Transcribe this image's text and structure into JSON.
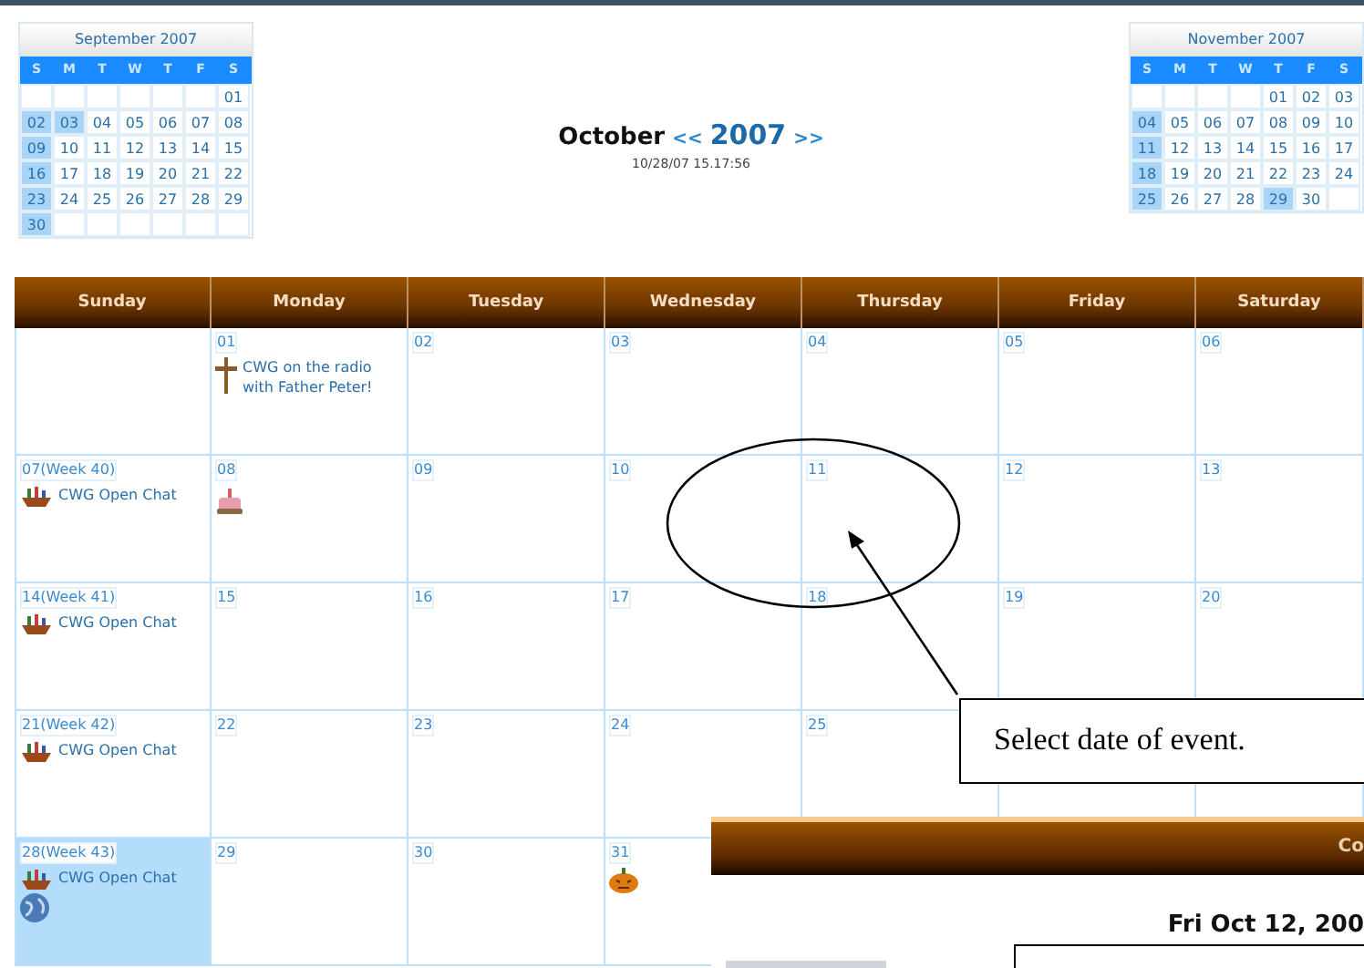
{
  "mini_calendars": [
    {
      "title": "September 2007",
      "weekday_headers": [
        "S",
        "M",
        "T",
        "W",
        "T",
        "F",
        "S"
      ],
      "weeks": [
        [
          {
            "day": "01",
            "highlighted": false
          }
        ],
        [
          {
            "day": "02",
            "highlighted": true
          },
          {
            "day": "03",
            "highlighted": true
          },
          {
            "day": "04",
            "highlighted": false
          },
          {
            "day": "05",
            "highlighted": false
          },
          {
            "day": "06",
            "highlighted": false
          },
          {
            "day": "07",
            "highlighted": false
          },
          {
            "day": "08",
            "highlighted": false
          }
        ],
        [
          {
            "day": "09",
            "highlighted": true
          },
          {
            "day": "10",
            "highlighted": false
          },
          {
            "day": "11",
            "highlighted": false
          },
          {
            "day": "12",
            "highlighted": false
          },
          {
            "day": "13",
            "highlighted": false
          },
          {
            "day": "14",
            "highlighted": false
          },
          {
            "day": "15",
            "highlighted": false
          }
        ],
        [
          {
            "day": "16",
            "highlighted": true
          },
          {
            "day": "17",
            "highlighted": false
          },
          {
            "day": "18",
            "highlighted": false
          },
          {
            "day": "19",
            "highlighted": false
          },
          {
            "day": "20",
            "highlighted": false
          },
          {
            "day": "21",
            "highlighted": false
          },
          {
            "day": "22",
            "highlighted": false
          }
        ],
        [
          {
            "day": "23",
            "highlighted": true
          },
          {
            "day": "24",
            "highlighted": false
          },
          {
            "day": "25",
            "highlighted": false
          },
          {
            "day": "26",
            "highlighted": false
          },
          {
            "day": "27",
            "highlighted": false
          },
          {
            "day": "28",
            "highlighted": false
          },
          {
            "day": "29",
            "highlighted": false
          }
        ],
        [
          {
            "day": "30",
            "highlighted": true
          }
        ]
      ]
    },
    {
      "title": "November 2007",
      "weekday_headers": [
        "S",
        "M",
        "T",
        "W",
        "T",
        "F",
        "S"
      ],
      "weeks": [
        [
          {
            "day": "01",
            "highlighted": false
          },
          {
            "day": "02",
            "highlighted": false
          },
          {
            "day": "03",
            "highlighted": false
          }
        ],
        [
          {
            "day": "04",
            "highlighted": true
          },
          {
            "day": "05",
            "highlighted": false
          },
          {
            "day": "06",
            "highlighted": false
          },
          {
            "day": "07",
            "highlighted": false
          },
          {
            "day": "08",
            "highlighted": false
          },
          {
            "day": "09",
            "highlighted": false
          },
          {
            "day": "10",
            "highlighted": false
          }
        ],
        [
          {
            "day": "11",
            "highlighted": true
          },
          {
            "day": "12",
            "highlighted": false
          },
          {
            "day": "13",
            "highlighted": false
          },
          {
            "day": "14",
            "highlighted": false
          },
          {
            "day": "15",
            "highlighted": false
          },
          {
            "day": "16",
            "highlighted": false
          },
          {
            "day": "17",
            "highlighted": false
          }
        ],
        [
          {
            "day": "18",
            "highlighted": true
          },
          {
            "day": "19",
            "highlighted": false
          },
          {
            "day": "20",
            "highlighted": false
          },
          {
            "day": "21",
            "highlighted": false
          },
          {
            "day": "22",
            "highlighted": false
          },
          {
            "day": "23",
            "highlighted": false
          },
          {
            "day": "24",
            "highlighted": false
          }
        ],
        [
          {
            "day": "25",
            "highlighted": true
          },
          {
            "day": "26",
            "highlighted": false
          },
          {
            "day": "27",
            "highlighted": false
          },
          {
            "day": "28",
            "highlighted": false
          },
          {
            "day": "29",
            "highlighted": true
          },
          {
            "day": "30",
            "highlighted": false
          }
        ]
      ]
    }
  ],
  "title": {
    "month": "October",
    "prev": "<<",
    "year": "2007",
    "next": ">>",
    "timestamp": "10/28/07 15.17:56"
  },
  "calendar": {
    "weekdays": [
      "Sunday",
      "Monday",
      "Tuesday",
      "Wednesday",
      "Thursday",
      "Friday",
      "Saturday"
    ],
    "weeks": [
      [
        {
          "date": "01",
          "highlighted": false,
          "events": [
            {
              "kind": "cross",
              "text": "CWG on the radio with Father Peter!"
            }
          ]
        },
        {
          "date": "02",
          "highlighted": false
        },
        {
          "date": "03",
          "highlighted": false
        },
        {
          "date": "04",
          "highlighted": false
        },
        {
          "date": "05",
          "highlighted": false
        },
        {
          "date": "06",
          "highlighted": false
        }
      ],
      [
        {
          "date": "07(Week 40)",
          "highlighted": false,
          "events": [
            {
              "kind": "boat",
              "text": "CWG Open Chat"
            }
          ]
        },
        {
          "date": "08",
          "highlighted": false,
          "events": [
            {
              "kind": "cake"
            }
          ]
        },
        {
          "date": "09",
          "highlighted": false
        },
        {
          "date": "10",
          "highlighted": false
        },
        {
          "date": "11",
          "highlighted": false
        },
        {
          "date": "12",
          "highlighted": false
        },
        {
          "date": "13",
          "highlighted": false
        }
      ],
      [
        {
          "date": "14(Week 41)",
          "highlighted": false,
          "events": [
            {
              "kind": "boat",
              "text": "CWG Open Chat"
            }
          ]
        },
        {
          "date": "15",
          "highlighted": false
        },
        {
          "date": "16",
          "highlighted": false
        },
        {
          "date": "17",
          "highlighted": false
        },
        {
          "date": "18",
          "highlighted": false
        },
        {
          "date": "19",
          "highlighted": false
        },
        {
          "date": "20",
          "highlighted": false
        }
      ],
      [
        {
          "date": "21(Week 42)",
          "highlighted": false,
          "events": [
            {
              "kind": "boat",
              "text": "CWG Open Chat"
            }
          ]
        },
        {
          "date": "22",
          "highlighted": false
        },
        {
          "date": "23",
          "highlighted": false
        },
        {
          "date": "24",
          "highlighted": false
        },
        {
          "date": "25",
          "highlighted": false
        }
      ],
      [
        {
          "date": "28(Week 43)",
          "highlighted": true,
          "events": [
            {
              "kind": "boat",
              "text": "CWG Open Chat"
            },
            {
              "kind": "globe"
            }
          ]
        },
        {
          "date": "29",
          "highlighted": false
        },
        {
          "date": "30",
          "highlighted": false
        },
        {
          "date": "31",
          "highlighted": false,
          "events": [
            {
              "kind": "pumpkin"
            }
          ]
        }
      ]
    ]
  },
  "popup": {
    "header": "Co",
    "date": "Fri Oct 12, 200"
  },
  "callout": {
    "text": "Select date of event."
  }
}
